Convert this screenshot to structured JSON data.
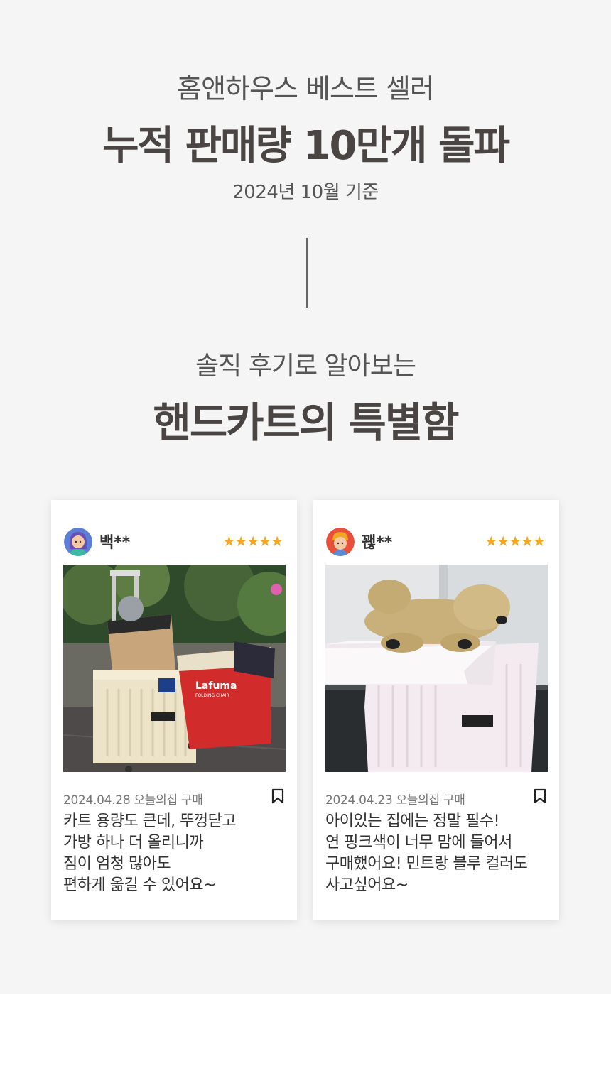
{
  "hero": {
    "kicker": "홈앤하우스 베스트 셀러",
    "headline": "누적 판매량 10만개 돌파",
    "subnote": "2024년 10월 기준"
  },
  "reviews_intro": {
    "kicker": "솔직 후기로 알아보는",
    "headline": "핸드카트의 특별함"
  },
  "reviews": [
    {
      "user": "백**",
      "stars": "★★★★★",
      "meta": "2024.04.28 오늘의집 구매",
      "lines": [
        "카트 용량도 큰데, 뚜껑닫고",
        "가방 하나 더 올리니까",
        "짐이 엄청 많아도",
        "편하게 옮길 수 있어요~"
      ],
      "photo_brand": "Lafuma",
      "photo_subbrand": "FOLDING CHAIR"
    },
    {
      "user": "꽪**",
      "stars": "★★★★★",
      "meta": "2024.04.23 오늘의집 구매",
      "lines": [
        "아이있는 집에는 정말 필수!",
        "연 핑크색이 너무 맘에 들어서",
        "구매했어요! 민트랑 블루 컬러도",
        "사고싶어요~"
      ]
    }
  ],
  "colors": {
    "section_bg": "#f5f5f5",
    "headline": "#4a4543",
    "star": "#f5a623"
  },
  "icons": {
    "avatar_1": "avatar-woman-icon",
    "avatar_2": "avatar-child-icon",
    "bookmark": "bookmark-icon",
    "star": "star-icon"
  }
}
